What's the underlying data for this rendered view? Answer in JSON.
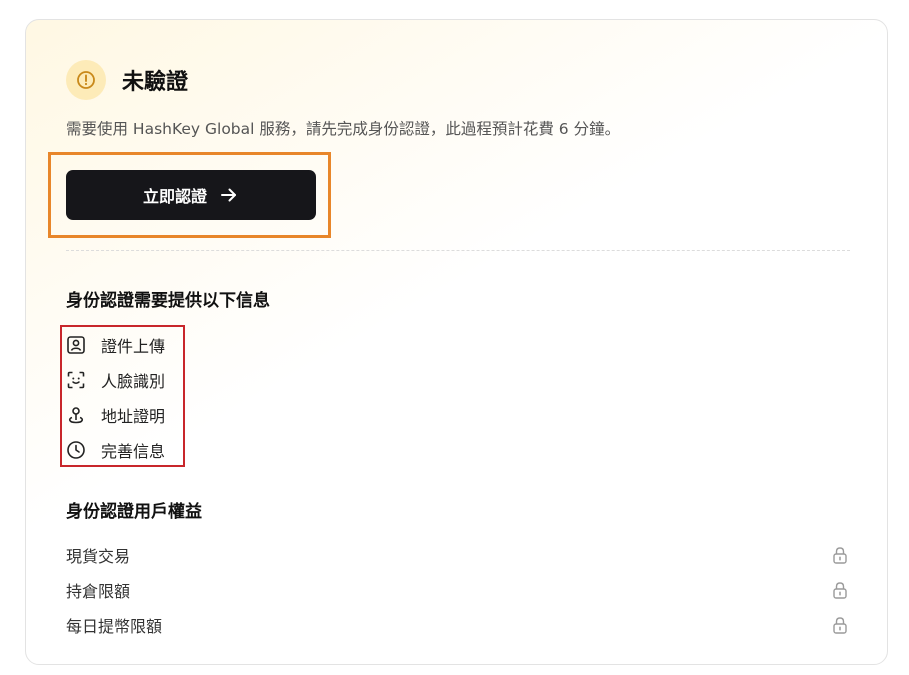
{
  "status": {
    "title": "未驗證",
    "icon": "warning-circle-icon",
    "badge_color": "#fdebb8",
    "icon_color": "#c9891a"
  },
  "description": "需要使用 HashKey Global 服務，請先完成身份認證，此過程預計花費 6 分鐘。",
  "verify_button": {
    "label": "立即認證",
    "icon": "arrow-right-icon"
  },
  "requirements": {
    "title": "身份認證需要提供以下信息",
    "items": [
      {
        "label": "證件上傳",
        "icon": "id-card-icon"
      },
      {
        "label": "人臉識別",
        "icon": "face-scan-icon"
      },
      {
        "label": "地址證明",
        "icon": "location-pin-icon"
      },
      {
        "label": "完善信息",
        "icon": "clock-icon"
      }
    ]
  },
  "benefits": {
    "title": "身份認證用戶權益",
    "items": [
      {
        "label": "現貨交易",
        "icon": "lock-icon"
      },
      {
        "label": "持倉限額",
        "icon": "lock-icon"
      },
      {
        "label": "每日提幣限額",
        "icon": "lock-icon"
      }
    ]
  },
  "colors": {
    "button_bg": "#16161a",
    "highlight_orange": "#e8862a",
    "highlight_red": "#c8262b"
  }
}
